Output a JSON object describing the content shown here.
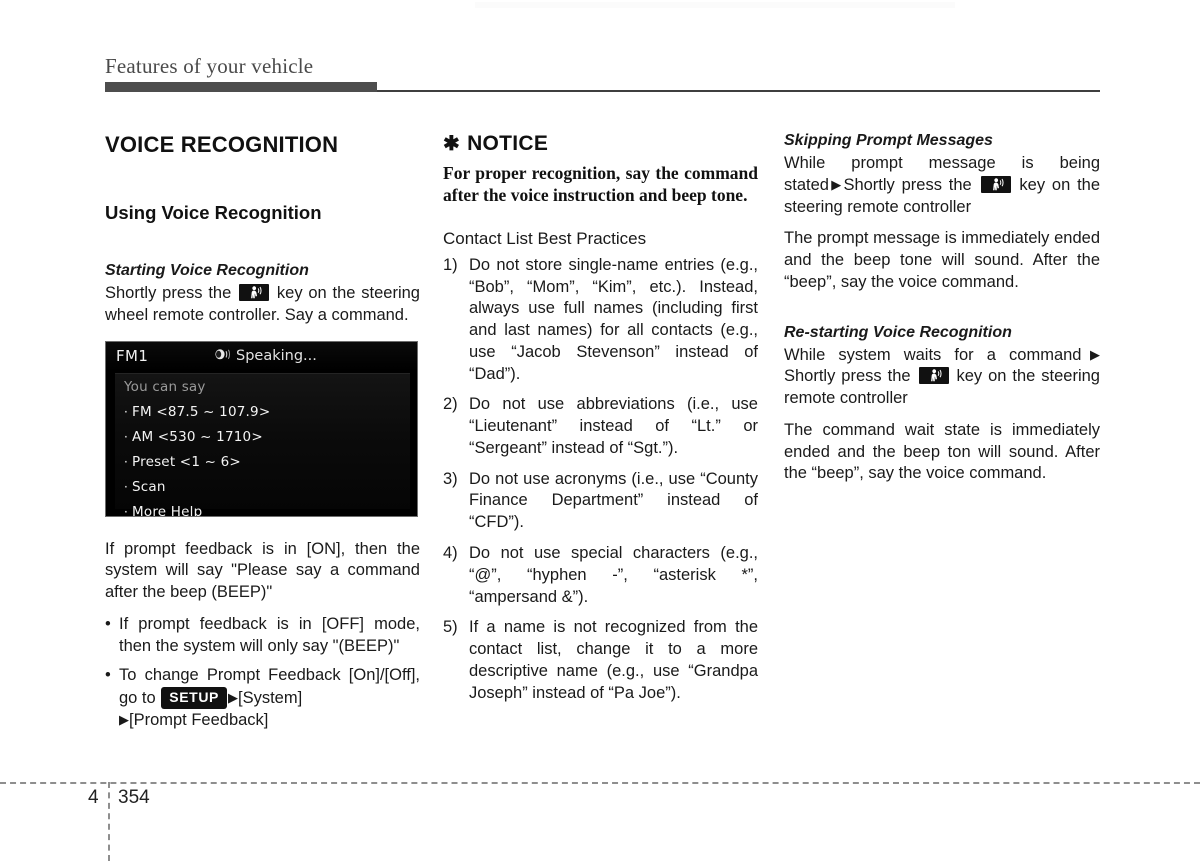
{
  "header": {
    "title": "Features of your vehicle"
  },
  "footer": {
    "chapter": "4",
    "page": "354"
  },
  "left_column": {
    "section_title": "VOICE RECOGNITION",
    "sub_title": "Using Voice Recognition",
    "starting": {
      "heading": "Starting Voice Recognition",
      "text_before_key": "Shortly press the",
      "text_after_key": "key on the steering wheel remote controller. Say a command."
    },
    "headunit": {
      "source_label": "FM1",
      "status_label": "Speaking...",
      "status_icon": "speaking-icon",
      "hint_label": "You can say",
      "items": [
        "FM <87.5 ~ 107.9>",
        "AM <530 ~ 1710>",
        "Preset <1 ~ 6>",
        "Scan",
        "More Help"
      ]
    },
    "prompt_on_text": "If prompt feedback is in [ON], then the system will say \"Please say a command after the beep (BEEP)\"",
    "bullets": [
      "If prompt feedback is in [OFF] mode, then the system will only say \"(BEEP)\"",
      "To change Prompt Feedback [On]/[Off], go to"
    ],
    "setup_badge": "SETUP",
    "setup_path_1": "[System]",
    "setup_path_2": "[Prompt Feedback]",
    "arrow_glyph": "▶"
  },
  "mid_column": {
    "notice": {
      "star": "✱",
      "heading": "NOTICE",
      "body": "For proper recognition, say the command after the voice instruction and beep tone."
    },
    "contact_heading": "Contact List Best Practices",
    "items": [
      {
        "num": "1)",
        "text": "Do not store single-name entries (e.g., “Bob”, “Mom”, “Kim”, etc.). Instead, always use full names (including first and last names) for all contacts (e.g., use “Jacob Stevenson” instead of “Dad”)."
      },
      {
        "num": "2)",
        "text": "Do not use abbreviations (i.e., use “Lieutenant” instead of “Lt.” or “Sergeant” instead of “Sgt.”)."
      },
      {
        "num": "3)",
        "text": "Do not use acronyms (i.e., use “County Finance Department” instead of “CFD”)."
      },
      {
        "num": "4)",
        "text": "Do not use special characters (e.g., “@”, “hyphen -”, “asterisk *”, “ampersand &”)."
      },
      {
        "num": "5)",
        "text": "If a name is not recognized from the contact list, change it to a more descriptive name (e.g., use “Grandpa Joseph” instead of “Pa Joe”)."
      }
    ]
  },
  "right_column": {
    "skipping": {
      "heading": "Skipping Prompt Messages",
      "text_before_arrow": "While prompt message is being stated",
      "text_before_key": "Shortly press the",
      "text_after_key": "key on the steering remote controller",
      "paragraph": "The prompt message is immediately ended and the beep tone will sound. After the “beep”, say the voice command."
    },
    "restarting": {
      "heading": "Re-starting Voice Recognition",
      "text_before_arrow": "While system waits for a command",
      "text_before_key": "Shortly press the",
      "text_after_key": "key on the steering remote controller",
      "paragraph": "The command wait state is immediately ended and the beep ton will sound. After the “beep”, say the voice command."
    },
    "arrow_glyph": "▶"
  }
}
